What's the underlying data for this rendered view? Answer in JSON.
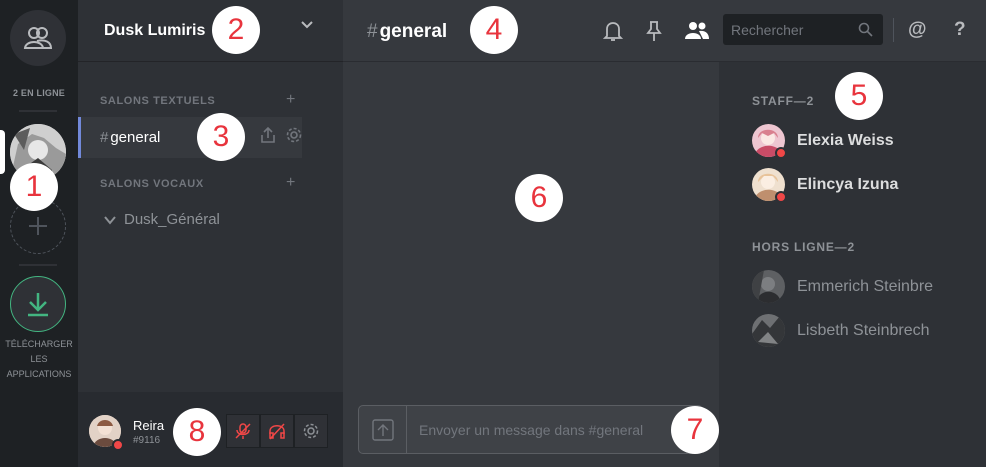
{
  "rail": {
    "online_label": "2 EN LIGNE",
    "download_label_1": "TÉLÉCHARGER",
    "download_label_2": "LES",
    "download_label_3": "APPLICATIONS"
  },
  "guild": {
    "name": "Dusk Lumiris",
    "text_category": "SALONS TEXTUELS",
    "voice_category": "SALONS VOCAUX",
    "active_channel": "general",
    "voice_channel": "Dusk_Général"
  },
  "user": {
    "name": "Reira",
    "tag": "#9116"
  },
  "header": {
    "channel": "general",
    "hash": "#",
    "search_placeholder": "Rechercher",
    "mention": "@",
    "help": "?"
  },
  "composer": {
    "placeholder": "Envoyer un message dans #general"
  },
  "members": {
    "staff_label": "STAFF—2",
    "offline_label": "HORS LIGNE—2",
    "staff": [
      {
        "name": "Elexia Weiss",
        "avatar_color": "#e6b3c0"
      },
      {
        "name": "Elincya Izuna",
        "avatar_color": "#e9d2c1"
      }
    ],
    "offline": [
      {
        "name": "Emmerich Steinbre",
        "avatar_color": "#6d6d6d"
      },
      {
        "name": "Lisbeth Steinbrech",
        "avatar_color": "#4a4a4a"
      }
    ]
  },
  "annotations": [
    "1",
    "2",
    "3",
    "4",
    "5",
    "6",
    "7",
    "8"
  ],
  "colors": {
    "accent": "#7289da",
    "dnd": "#f04747",
    "download": "#43b581",
    "annotation": "#e8343d"
  }
}
